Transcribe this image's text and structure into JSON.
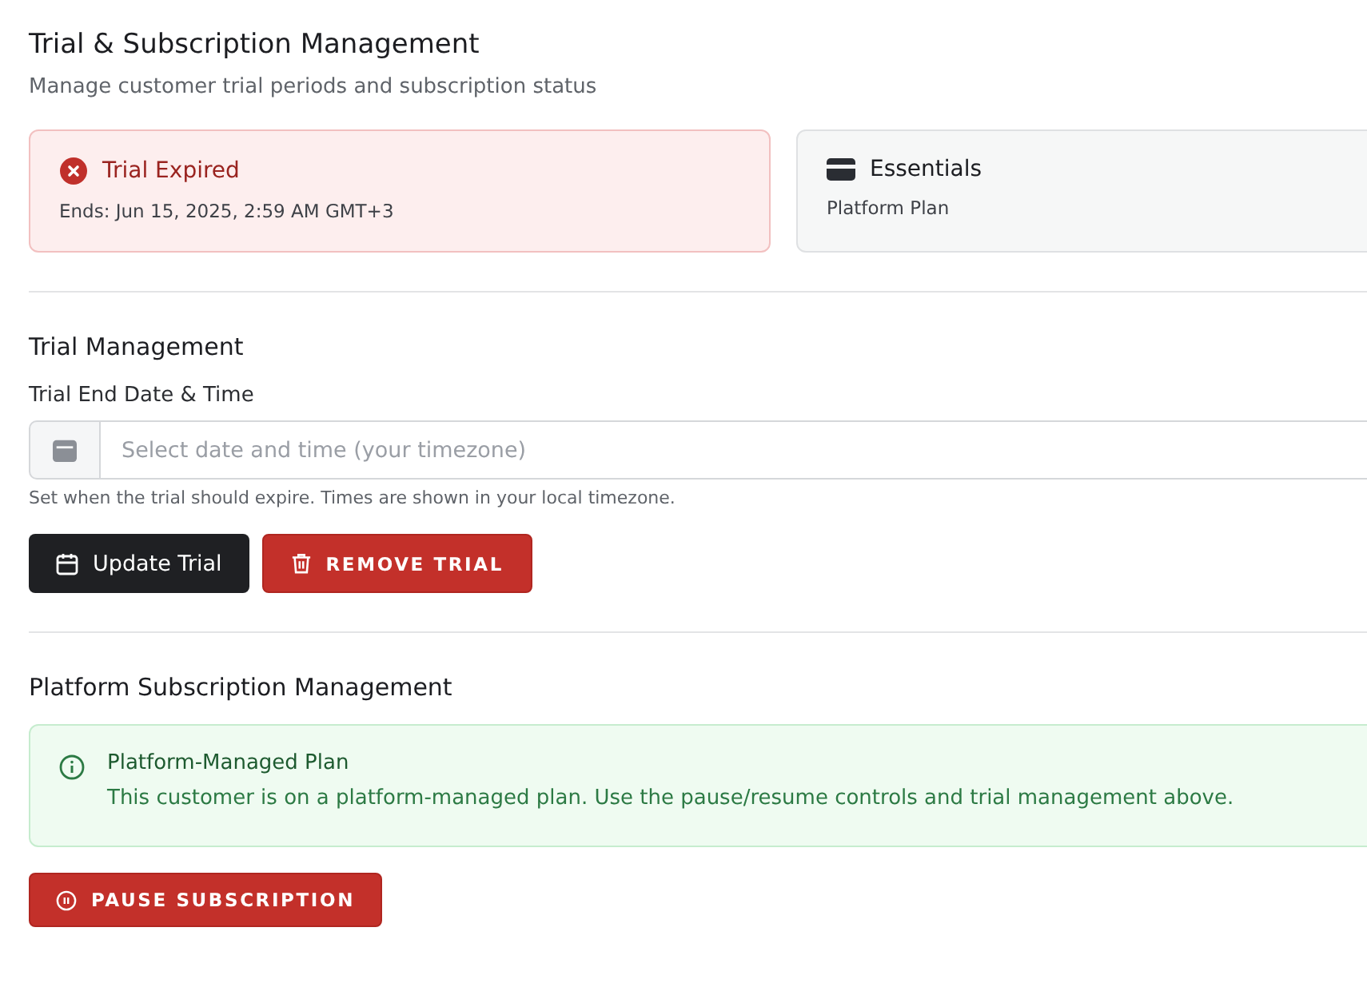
{
  "header": {
    "title": "Trial & Subscription Management",
    "subtitle": "Manage customer trial periods and subscription status"
  },
  "status_cards": [
    {
      "kind": "expired",
      "title": "Trial Expired",
      "detail": "Ends: Jun 15, 2025, 2:59 AM GMT+3"
    },
    {
      "kind": "plan",
      "title": "Essentials",
      "detail": "Platform Plan"
    }
  ],
  "trial_management": {
    "heading": "Trial Management",
    "field_label": "Trial End Date & Time",
    "placeholder": "Select date and time (your timezone)",
    "help": "Set when the trial should expire. Times are shown in your local timezone.",
    "buttons": [
      {
        "kind": "primary",
        "label": "Update Trial"
      },
      {
        "kind": "danger",
        "label": "REMOVE TRIAL"
      }
    ]
  },
  "subscription": {
    "heading": "Platform Subscription Management",
    "notice": {
      "title": "Platform-Managed Plan",
      "text": "This customer is on a platform-managed plan. Use the pause/resume controls and trial management above."
    },
    "buttons": [
      {
        "kind": "danger",
        "label": "PAUSE SUBSCRIPTION"
      }
    ]
  }
}
